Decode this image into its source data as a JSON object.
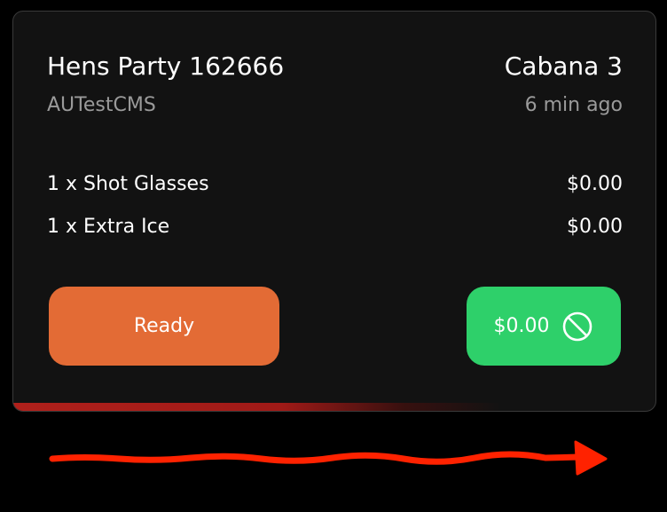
{
  "order": {
    "title": "Hens Party 162666",
    "subtitle": "AUTestCMS",
    "location": "Cabana 3",
    "time_ago": "6 min ago",
    "items": [
      {
        "label": "1 x Shot Glasses",
        "price": "$0.00"
      },
      {
        "label": "1 x Extra Ice",
        "price": "$0.00"
      }
    ]
  },
  "actions": {
    "ready_label": "Ready",
    "pay_label": "$0.00",
    "pay_icon": "prohibited-icon"
  },
  "timer": {
    "elapsed_fraction": 0.76,
    "color": "#b0201b"
  },
  "swipe_hint": {
    "icon": "swipe-right-arrow-icon",
    "color": "#ff2200"
  },
  "colors": {
    "card_bg": "#121212",
    "ready_button": "#e36b35",
    "pay_button": "#2ed06a",
    "muted_text": "#9a9a9a"
  }
}
